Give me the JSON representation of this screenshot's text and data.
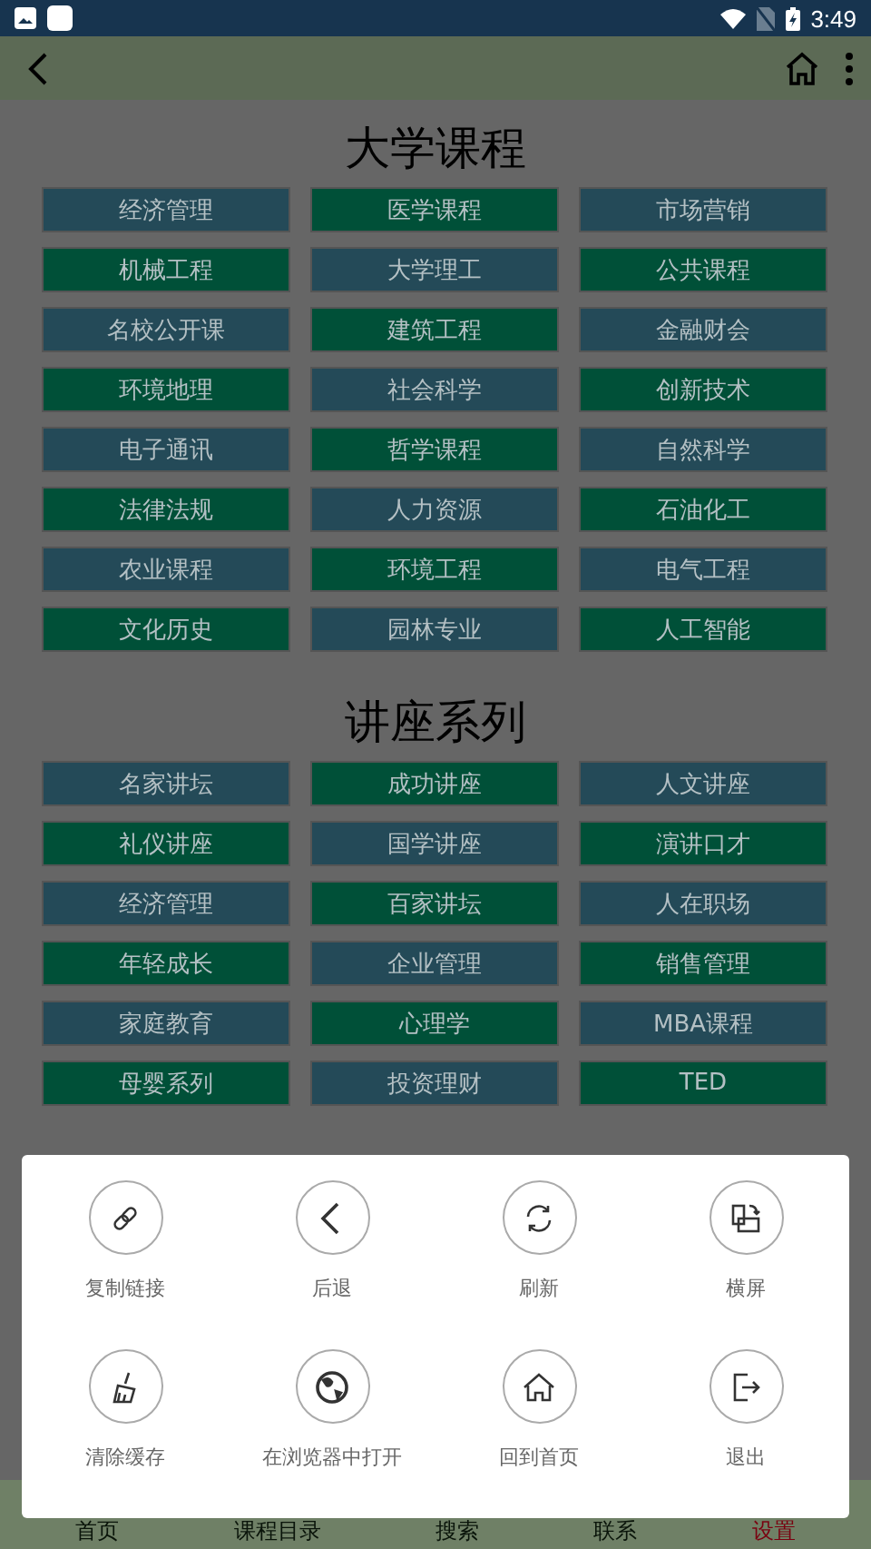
{
  "status_bar": {
    "time": "3:49"
  },
  "sections": [
    {
      "title": "大学课程",
      "tiles": [
        {
          "label": "经济管理",
          "color": "#244a58"
        },
        {
          "label": "医学课程",
          "color": "#005038"
        },
        {
          "label": "市场营销",
          "color": "#244a58"
        },
        {
          "label": "机械工程",
          "color": "#005038"
        },
        {
          "label": "大学理工",
          "color": "#244a58"
        },
        {
          "label": "公共课程",
          "color": "#005038"
        },
        {
          "label": "名校公开课",
          "color": "#244a58"
        },
        {
          "label": "建筑工程",
          "color": "#005038"
        },
        {
          "label": "金融财会",
          "color": "#244a58"
        },
        {
          "label": "环境地理",
          "color": "#005038"
        },
        {
          "label": "社会科学",
          "color": "#244a58"
        },
        {
          "label": "创新技术",
          "color": "#005038"
        },
        {
          "label": "电子通讯",
          "color": "#244a58"
        },
        {
          "label": "哲学课程",
          "color": "#005038"
        },
        {
          "label": "自然科学",
          "color": "#244a58"
        },
        {
          "label": "法律法规",
          "color": "#005038"
        },
        {
          "label": "人力资源",
          "color": "#244a58"
        },
        {
          "label": "石油化工",
          "color": "#005038"
        },
        {
          "label": "农业课程",
          "color": "#244a58"
        },
        {
          "label": "环境工程",
          "color": "#005038"
        },
        {
          "label": "电气工程",
          "color": "#244a58"
        },
        {
          "label": "文化历史",
          "color": "#005038"
        },
        {
          "label": "园林专业",
          "color": "#244a58"
        },
        {
          "label": "人工智能",
          "color": "#005038"
        }
      ]
    },
    {
      "title": "讲座系列",
      "tiles": [
        {
          "label": "名家讲坛",
          "color": "#244a58"
        },
        {
          "label": "成功讲座",
          "color": "#005038"
        },
        {
          "label": "人文讲座",
          "color": "#244a58"
        },
        {
          "label": "礼仪讲座",
          "color": "#005038"
        },
        {
          "label": "国学讲座",
          "color": "#244a58"
        },
        {
          "label": "演讲口才",
          "color": "#005038"
        },
        {
          "label": "经济管理",
          "color": "#244a58"
        },
        {
          "label": "百家讲坛",
          "color": "#005038"
        },
        {
          "label": "人在职场",
          "color": "#244a58"
        },
        {
          "label": "年轻成长",
          "color": "#005038"
        },
        {
          "label": "企业管理",
          "color": "#244a58"
        },
        {
          "label": "销售管理",
          "color": "#005038"
        },
        {
          "label": "家庭教育",
          "color": "#244a58"
        },
        {
          "label": "心理学",
          "color": "#005038"
        },
        {
          "label": "MBA课程",
          "color": "#244a58"
        },
        {
          "label": "母婴系列",
          "color": "#005038"
        },
        {
          "label": "投资理财",
          "color": "#244a58"
        },
        {
          "label": "TED",
          "color": "#005038"
        }
      ]
    }
  ],
  "bottom_nav": [
    {
      "label": "首页",
      "selected": false
    },
    {
      "label": "课程目录",
      "selected": false
    },
    {
      "label": "搜索",
      "selected": false
    },
    {
      "label": "联系",
      "selected": false
    },
    {
      "label": "设置",
      "selected": true
    }
  ],
  "dialog": {
    "actions": [
      {
        "label": "复制链接"
      },
      {
        "label": "后退"
      },
      {
        "label": "刷新"
      },
      {
        "label": "横屏"
      },
      {
        "label": "清除缓存"
      },
      {
        "label": "在浏览器中打开"
      },
      {
        "label": "回到首页"
      },
      {
        "label": "退出"
      }
    ]
  }
}
